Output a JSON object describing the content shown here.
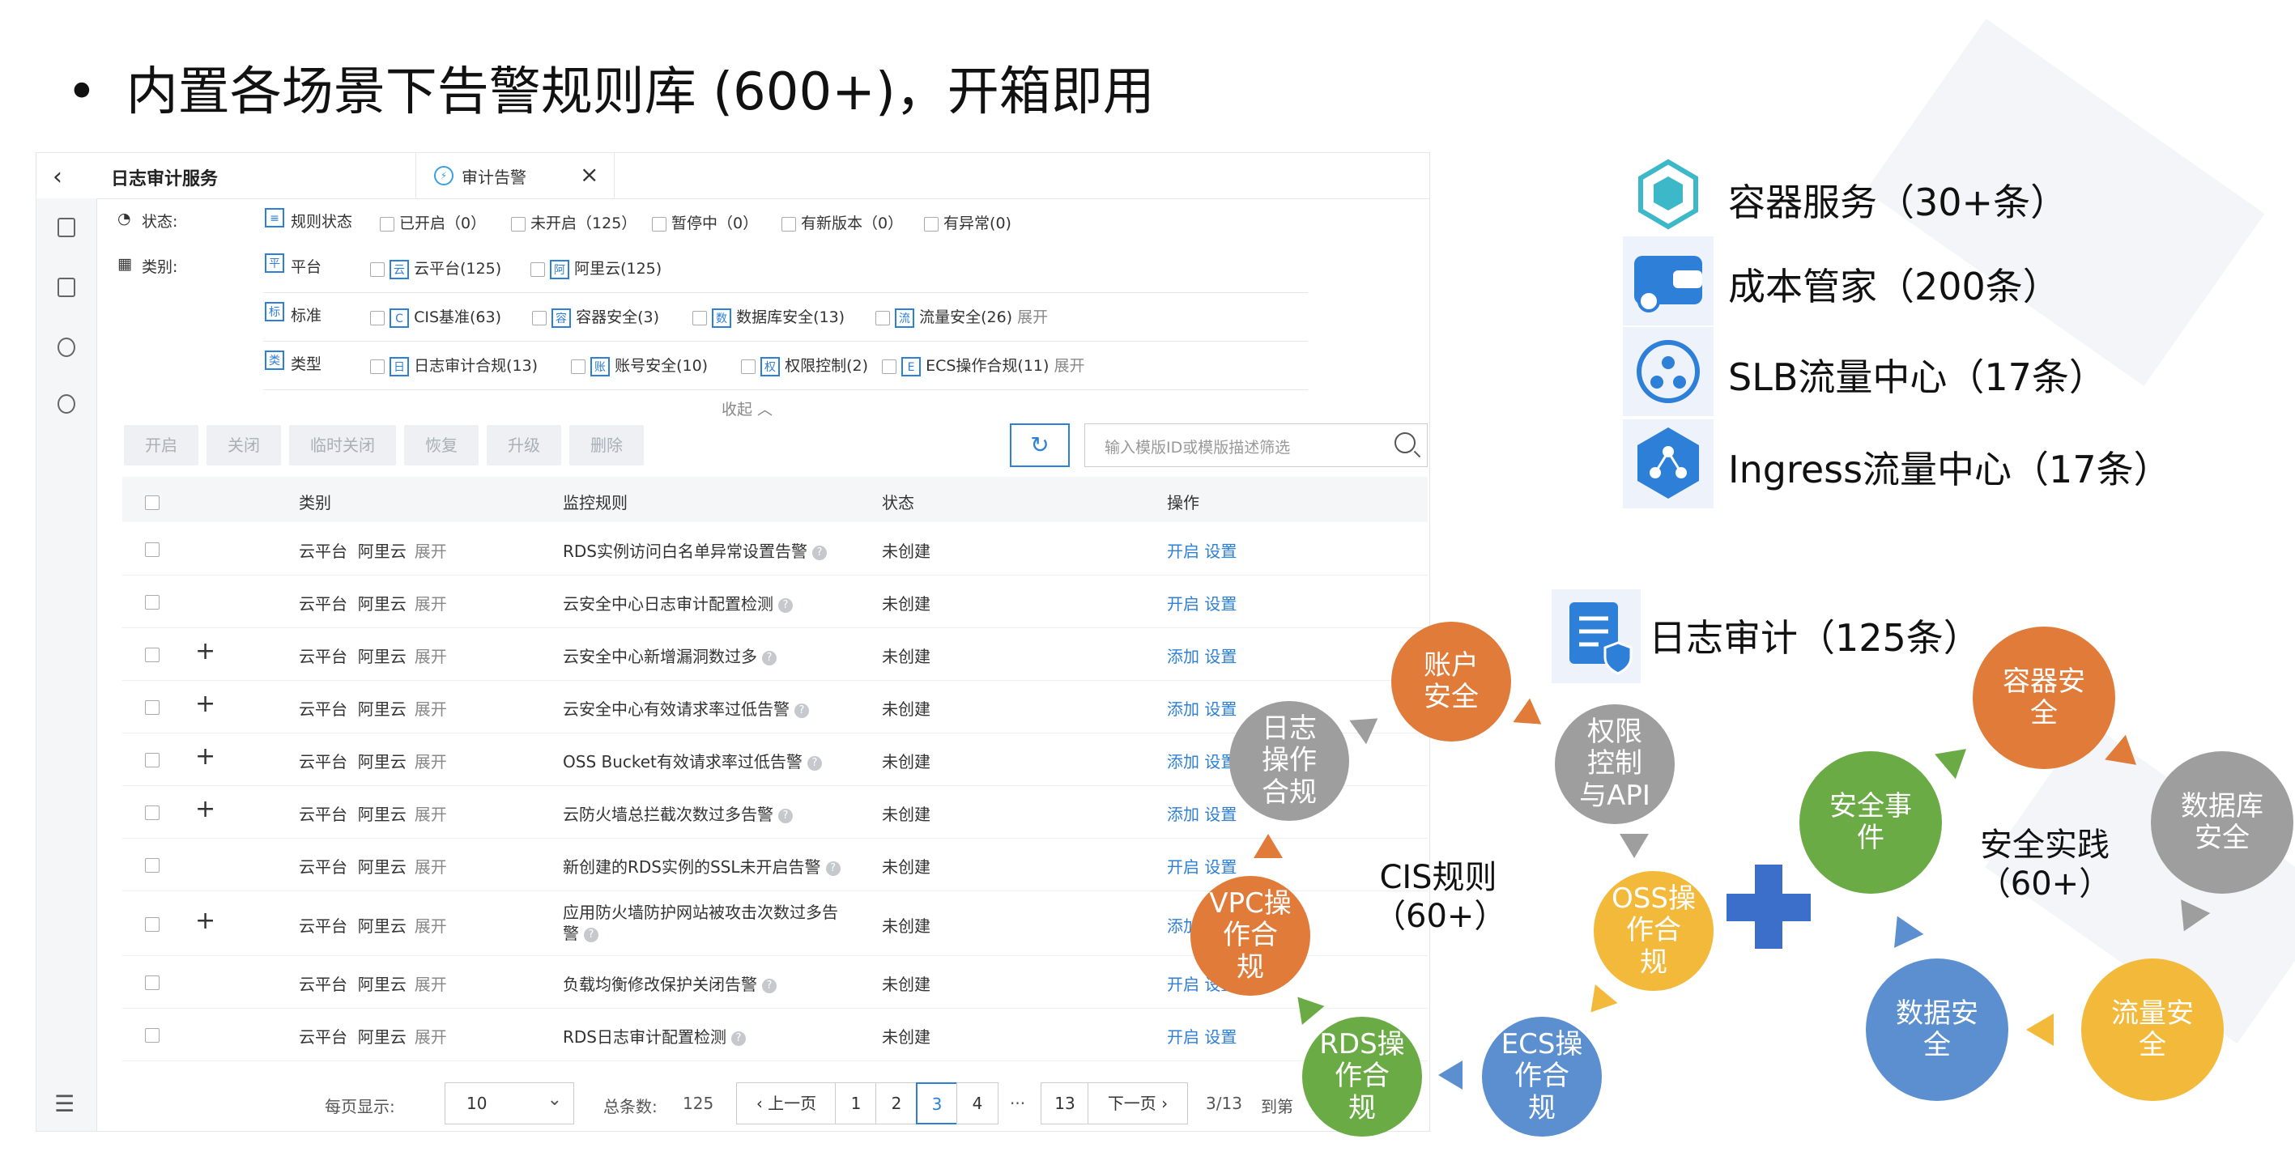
{
  "slide_title": "内置各场景下告警规则库 (600+)，开箱即用",
  "app": {
    "service_title": "日志审计服务",
    "tab_label": "审计告警",
    "filters": {
      "status_label": "状态:",
      "status_group": "规则状态",
      "status_options": [
        "已开启（0）",
        "未开启（125）",
        "暂停中（0）",
        "有新版本（0）",
        "有异常(0)"
      ],
      "category_label": "类别:",
      "platform_group": "平台",
      "platform_options": [
        "云平台(125)",
        "阿里云(125)"
      ],
      "platform_tags": [
        "云",
        "阿"
      ],
      "standard_group": "标准",
      "standard_options": [
        "CIS基准(63)",
        "容器安全(3)",
        "数据库安全(13)",
        "流量安全(26)"
      ],
      "standard_tags": [
        "C",
        "容",
        "数",
        "流"
      ],
      "type_group": "类型",
      "type_options": [
        "日志审计合规(13)",
        "账号安全(10)",
        "权限控制(2)",
        "ECS操作合规(11)"
      ],
      "type_tags": [
        "日",
        "账",
        "权",
        "E"
      ],
      "expand": "展开",
      "collapse": "收起"
    },
    "toolbar": [
      "开启",
      "关闭",
      "临时关闭",
      "恢复",
      "升级",
      "删除"
    ],
    "search_placeholder": "输入模版ID或模版描述筛选",
    "columns": [
      "类别",
      "监控规则",
      "状态",
      "操作"
    ],
    "rows": [
      {
        "plus": "",
        "cat1": "云平台",
        "cat2": "阿里云",
        "expand": "展开",
        "rule": "RDS实例访问白名单异常设置告警",
        "status": "未创建",
        "act1": "开启",
        "act2": "设置"
      },
      {
        "plus": "",
        "cat1": "云平台",
        "cat2": "阿里云",
        "expand": "展开",
        "rule": "云安全中心日志审计配置检测",
        "status": "未创建",
        "act1": "开启",
        "act2": "设置"
      },
      {
        "plus": "+",
        "cat1": "云平台",
        "cat2": "阿里云",
        "expand": "展开",
        "rule": "云安全中心新增漏洞数过多",
        "status": "未创建",
        "act1": "添加",
        "act2": "设置"
      },
      {
        "plus": "+",
        "cat1": "云平台",
        "cat2": "阿里云",
        "expand": "展开",
        "rule": "云安全中心有效请求率过低告警",
        "status": "未创建",
        "act1": "添加",
        "act2": "设置"
      },
      {
        "plus": "+",
        "cat1": "云平台",
        "cat2": "阿里云",
        "expand": "展开",
        "rule": "OSS Bucket有效请求率过低告警",
        "status": "未创建",
        "act1": "添加",
        "act2": "设置"
      },
      {
        "plus": "+",
        "cat1": "云平台",
        "cat2": "阿里云",
        "expand": "展开",
        "rule": "云防火墙总拦截次数过多告警",
        "status": "未创建",
        "act1": "添加",
        "act2": "设置"
      },
      {
        "plus": "",
        "cat1": "云平台",
        "cat2": "阿里云",
        "expand": "展开",
        "rule": "新创建的RDS实例的SSL未开启告警",
        "status": "未创建",
        "act1": "开启",
        "act2": "设置"
      },
      {
        "plus": "+",
        "cat1": "云平台",
        "cat2": "阿里云",
        "expand": "展开",
        "rule": "应用防火墙防护网站被攻击次数过多告警",
        "status": "未创建",
        "act1": "添加",
        "act2": "设"
      },
      {
        "plus": "",
        "cat1": "云平台",
        "cat2": "阿里云",
        "expand": "展开",
        "rule": "负载均衡修改保护关闭告警",
        "status": "未创建",
        "act1": "开启",
        "act2": "设置"
      },
      {
        "plus": "",
        "cat1": "云平台",
        "cat2": "阿里云",
        "expand": "展开",
        "rule": "RDS日志审计配置检测",
        "status": "未创建",
        "act1": "开启",
        "act2": "设置"
      }
    ],
    "pager": {
      "per_page_label": "每页显示:",
      "per_page_value": "10",
      "total_label": "总条数:",
      "total_value": "125",
      "prev": "上一页",
      "pages": [
        "1",
        "2",
        "3",
        "4"
      ],
      "ellipsis": "···",
      "last_page": "13",
      "next": "下一页",
      "current_of": "3/13",
      "goto_label": "到第"
    }
  },
  "legend": [
    {
      "text": "容器服务（30+条）",
      "icon": "container-icon"
    },
    {
      "text": "成本管家（200条）",
      "icon": "wallet-icon"
    },
    {
      "text": "SLB流量中心（17条）",
      "icon": "slb-icon"
    },
    {
      "text": "Ingress流量中心（17条）",
      "icon": "ingress-icon"
    }
  ],
  "log_audit_label": "日志审计（125条）",
  "cis_label": "CIS规则\n（60+）",
  "practice_label": "安全实践\n（60+）",
  "cis_cycle": [
    "账户\n安全",
    "权限\n控制\n与API",
    "OSS操\n作合\n规",
    "ECS操\n作合\n规",
    "RDS操\n作合\n规",
    "VPC操\n作合\n规",
    "日志\n操作\n合规"
  ],
  "practice_cycle": [
    "容器安\n全",
    "数据库\n安全",
    "流量安\n全",
    "数据安\n全",
    "安全事\n件"
  ],
  "colors": {
    "accent": "#2d7fd8",
    "orange": "#e07b39",
    "gray": "#9e9e9e",
    "yellow": "#f2b93b",
    "blue": "#5b8fcf",
    "green": "#6aab45"
  }
}
